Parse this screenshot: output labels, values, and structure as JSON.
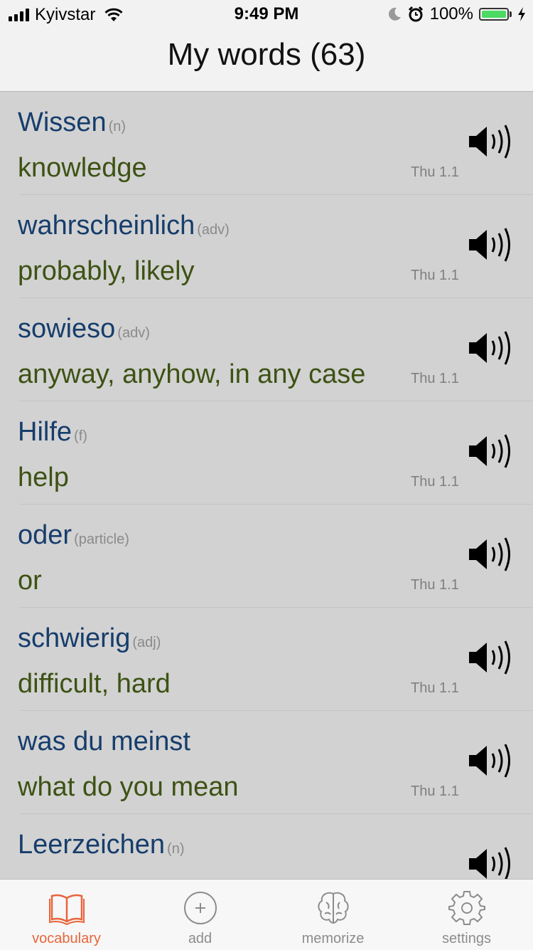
{
  "status": {
    "carrier": "Kyivstar",
    "time": "9:49 PM",
    "battery": "100%"
  },
  "nav": {
    "title": "My words (63)"
  },
  "words": [
    {
      "word": "Wissen",
      "pos": "(n)",
      "translation": "knowledge",
      "date": "Thu 1.1"
    },
    {
      "word": "wahrscheinlich",
      "pos": "(adv)",
      "translation": "probably, likely",
      "date": "Thu 1.1"
    },
    {
      "word": "sowieso",
      "pos": "(adv)",
      "translation": "anyway, anyhow, in any case",
      "date": "Thu 1.1"
    },
    {
      "word": "Hilfe",
      "pos": "(f)",
      "translation": "help",
      "date": "Thu 1.1"
    },
    {
      "word": "oder",
      "pos": "(particle)",
      "translation": "or",
      "date": "Thu 1.1"
    },
    {
      "word": "schwierig",
      "pos": "(adj)",
      "translation": "difficult, hard",
      "date": "Thu 1.1"
    },
    {
      "word": "was du meinst",
      "pos": "",
      "translation": "what do you mean",
      "date": "Thu 1.1"
    },
    {
      "word": "Leerzeichen",
      "pos": "(n)",
      "translation": "",
      "date": ""
    }
  ],
  "tabs": [
    {
      "label": "vocabulary",
      "icon": "book-icon",
      "active": true
    },
    {
      "label": "add",
      "icon": "plus-circle-icon",
      "active": false
    },
    {
      "label": "memorize",
      "icon": "brain-icon",
      "active": false
    },
    {
      "label": "settings",
      "icon": "gear-icon",
      "active": false
    }
  ],
  "colors": {
    "accent": "#e8653c",
    "word": "#163d6c",
    "translation": "#3d5214",
    "list_background": "#d2d2d2"
  }
}
